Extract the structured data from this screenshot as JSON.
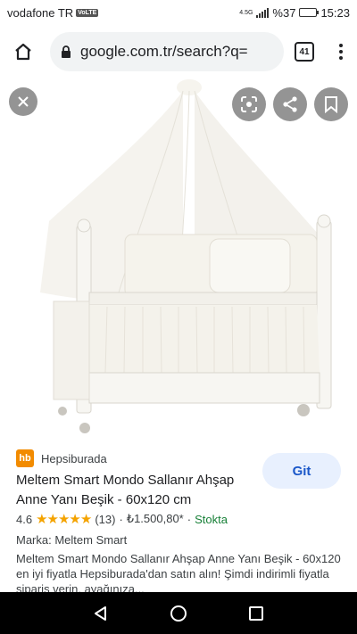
{
  "status_bar": {
    "carrier": "vodafone TR",
    "volte": "VoLTE",
    "network": "4.5G",
    "battery": "%37",
    "time": "15:23"
  },
  "browser": {
    "url": "google.com.tr/search?q=",
    "tab_count": "41"
  },
  "result": {
    "source_logo": "hb",
    "source_name": "Hepsiburada",
    "visit_label": "Git",
    "title": "Meltem Smart Mondo Sallanır Ahşap Anne Yanı Beşik - 60x120 cm",
    "rating": "4.6",
    "stars": "★★★★★",
    "review_count": "(13)",
    "separator": "·",
    "price": "₺1.500,80*",
    "stock": "Stokta",
    "brand": "Marka: Meltem Smart",
    "description": "Meltem Smart Mondo Sallanır Ahşap Anne Yanı Beşik - 60x120 en iyi fiyatla Hepsiburada'dan satın alın! Şimdi indirimli fiyatla sipariş verin, ayağınıza..."
  },
  "colors": {
    "accent": "#1a57c9",
    "hb_orange": "#f28b00",
    "star": "#f4a300",
    "stock_green": "#188038"
  }
}
